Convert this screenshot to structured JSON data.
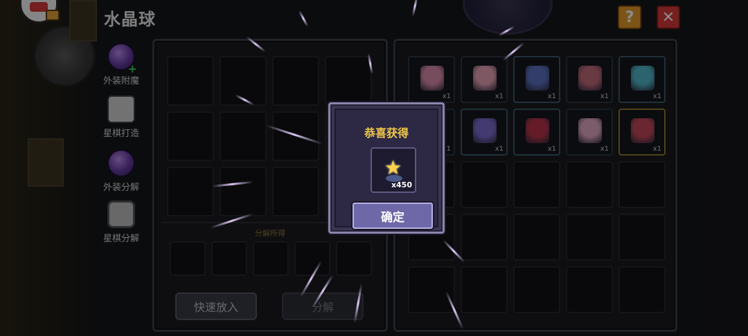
{
  "header": {
    "title": "水晶球"
  },
  "top_buttons": {
    "help_label": "?",
    "close_label": "✕"
  },
  "side_menu": {
    "items": [
      {
        "label": "外装附魔",
        "icon": "crystal-orb-icon"
      },
      {
        "label": "星棋打造",
        "icon": "stone-chess-icon"
      },
      {
        "label": "外装分解",
        "icon": "crystal-orb-icon"
      },
      {
        "label": "星棋分解",
        "icon": "stone-chess-icon",
        "active": true
      }
    ]
  },
  "left_panel": {
    "result_label": "分解所得",
    "quick_add_label": "快速放入",
    "decompose_label": "分解"
  },
  "inventory": {
    "items": [
      {
        "icon": "pink-mask-icon",
        "qty": "x1",
        "color": "#d98aa8"
      },
      {
        "icon": "pink-flower-icon",
        "qty": "x1",
        "color": "#e6a2b4"
      },
      {
        "icon": "horned-helmet-icon",
        "qty": "x1",
        "color": "#5b6fc0"
      },
      {
        "icon": "staff-icon",
        "qty": "x1",
        "color": "#c26a7a"
      },
      {
        "icon": "blue-feather-icon",
        "qty": "x1",
        "color": "#4fb6c9"
      },
      {
        "icon": "",
        "qty": "x1",
        "color": ""
      },
      {
        "icon": "purple-feather-icon",
        "qty": "x1",
        "color": "#7b6ad0"
      },
      {
        "icon": "red-armor-icon",
        "qty": "x1",
        "color": "#b8344a"
      },
      {
        "icon": "pink-horns-icon",
        "qty": "x1",
        "color": "#e2a6c4"
      },
      {
        "icon": "red-book-icon",
        "qty": "x1",
        "color": "#c4485a"
      }
    ]
  },
  "modal": {
    "title": "恭喜获得",
    "reward_icon": "star-icon",
    "reward_qty": "x450",
    "confirm_label": "确定"
  }
}
